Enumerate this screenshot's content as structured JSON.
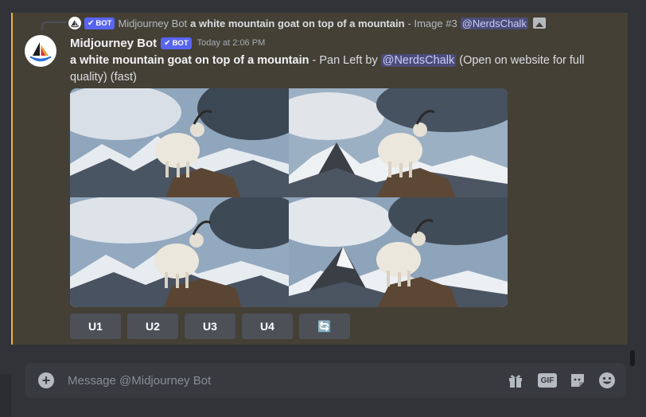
{
  "reply": {
    "author": "Midjourney Bot",
    "bot_label": "BOT",
    "prompt": "a white mountain goat on top of a mountain",
    "suffix": "- Image #3",
    "mention": "@NerdsChalk",
    "attachment_icon": "image-icon"
  },
  "message": {
    "author": "Midjourney Bot",
    "bot_label": "BOT",
    "timestamp": "Today at 2:06 PM",
    "prompt": "a white mountain goat on top of a mountain",
    "action_text": " - Pan Left by ",
    "mention": "@NerdsChalk",
    "tail_text": " (Open on website for full quality) (fast)"
  },
  "image_grid": {
    "alt": "a white mountain goat on top of a mountain",
    "tiles": 4
  },
  "buttons": [
    "U1",
    "U2",
    "U3",
    "U4"
  ],
  "refresh_button": {
    "icon": "refresh-icon",
    "glyph": "🔄"
  },
  "composer": {
    "placeholder": "Message @Midjourney Bot",
    "value": "",
    "gif_label": "GIF",
    "icons": [
      "add-icon",
      "gift-icon",
      "gif-icon",
      "sticker-icon",
      "emoji-icon"
    ]
  },
  "colors": {
    "highlight_background": "#444036",
    "highlight_border": "#f0b232",
    "bot_tag": "#5865f2",
    "mention": "#c9cdfb",
    "app_background": "#313338",
    "composer_background": "#383a40"
  }
}
